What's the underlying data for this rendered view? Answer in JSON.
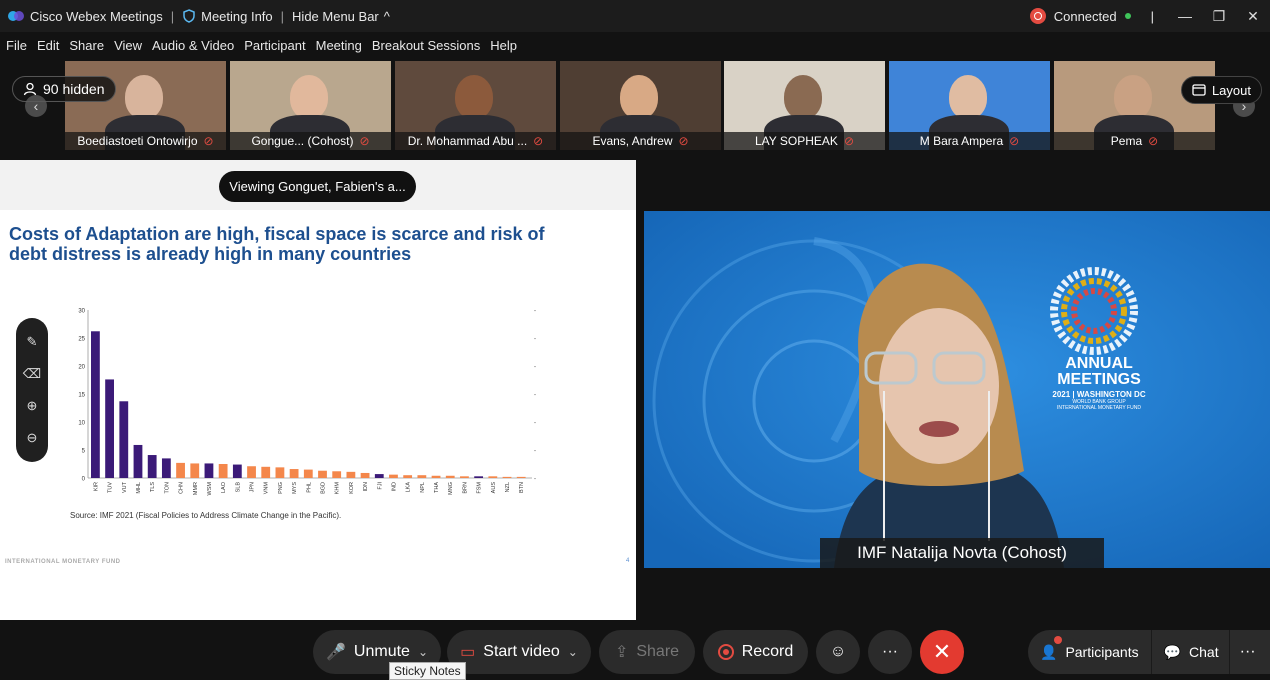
{
  "window": {
    "app_title": "Cisco Webex Meetings",
    "meeting_info": "Meeting Info",
    "hide_menu": "Hide Menu Bar",
    "status": "Connected"
  },
  "menu": [
    "File",
    "Edit",
    "Share",
    "View",
    "Audio & Video",
    "Participant",
    "Meeting",
    "Breakout Sessions",
    "Help"
  ],
  "filmstrip": {
    "hidden_count": "90 hidden",
    "layout_label": "Layout",
    "participants": [
      {
        "name": "Boediastoeti Ontowirjo"
      },
      {
        "name": "Gongue... (Cohost)"
      },
      {
        "name": "Dr. Mohammad Abu ..."
      },
      {
        "name": "Evans, Andrew"
      },
      {
        "name": "LAY SOPHEAK"
      },
      {
        "name": "M Bara Ampera"
      },
      {
        "name": "Pema"
      }
    ]
  },
  "share": {
    "viewing_label": "Viewing Gonguet, Fabien's a...",
    "slide_title_line1": "Costs of Adaptation are high, fiscal space is scarce and risk of",
    "slide_title_line2": "debt distress is already high in many countries",
    "source": "Source: IMF 2021 (Fiscal Policies to Address Climate Change in the Pacific).",
    "footer": "INTERNATIONAL MONETARY FUND",
    "page": "4"
  },
  "chart_data": {
    "type": "bar",
    "categories": [
      "KIR",
      "TUV",
      "VUT",
      "MHL",
      "TLS",
      "TON",
      "CHN",
      "MMR",
      "WSM",
      "LAO",
      "SLB",
      "JPN",
      "VNM",
      "PNG",
      "MYS",
      "PHL",
      "BGD",
      "KHM",
      "KOR",
      "IDN",
      "FJI",
      "IND",
      "LKA",
      "NPL",
      "THA",
      "MNG",
      "BRN",
      "FSM",
      "AUS",
      "NZL",
      "BTN"
    ],
    "values": [
      26.2,
      17.6,
      13.7,
      5.9,
      4.1,
      3.5,
      2.7,
      2.6,
      2.6,
      2.5,
      2.4,
      2.1,
      2.0,
      1.9,
      1.6,
      1.5,
      1.3,
      1.2,
      1.1,
      0.9,
      0.7,
      0.6,
      0.5,
      0.5,
      0.4,
      0.4,
      0.3,
      0.3,
      0.3,
      0.2,
      0.2
    ],
    "colors": [
      "#3b1a78",
      "#3b1a78",
      "#3b1a78",
      "#3b1a78",
      "#3b1a78",
      "#3b1a78",
      "#f4874b",
      "#f4874b",
      "#3b1a78",
      "#f4874b",
      "#3b1a78",
      "#f4874b",
      "#f4874b",
      "#f4874b",
      "#f4874b",
      "#f4874b",
      "#f4874b",
      "#f4874b",
      "#f4874b",
      "#f4874b",
      "#3b1a78",
      "#f4874b",
      "#f4874b",
      "#f4874b",
      "#f4874b",
      "#f4874b",
      "#f4874b",
      "#3b1a78",
      "#f4874b",
      "#f4874b",
      "#f4874b"
    ],
    "ylim": [
      0,
      30
    ],
    "yticks": [
      0,
      5,
      10,
      15,
      20,
      25,
      30
    ],
    "title": "",
    "xlabel": "",
    "ylabel": ""
  },
  "speaker": {
    "label": "IMF Natalija Novta (Cohost)",
    "banner_line1": "ANNUAL",
    "banner_line2": "MEETINGS",
    "banner_line3": "2021 | WASHINGTON DC",
    "banner_line4": "WORLD BANK GROUP",
    "banner_line5": "INTERNATIONAL MONETARY FUND"
  },
  "toolbar": {
    "unmute": "Unmute",
    "start_video": "Start video",
    "share": "Share",
    "record": "Record",
    "participants": "Participants",
    "chat": "Chat",
    "tooltip": "Sticky Notes"
  }
}
